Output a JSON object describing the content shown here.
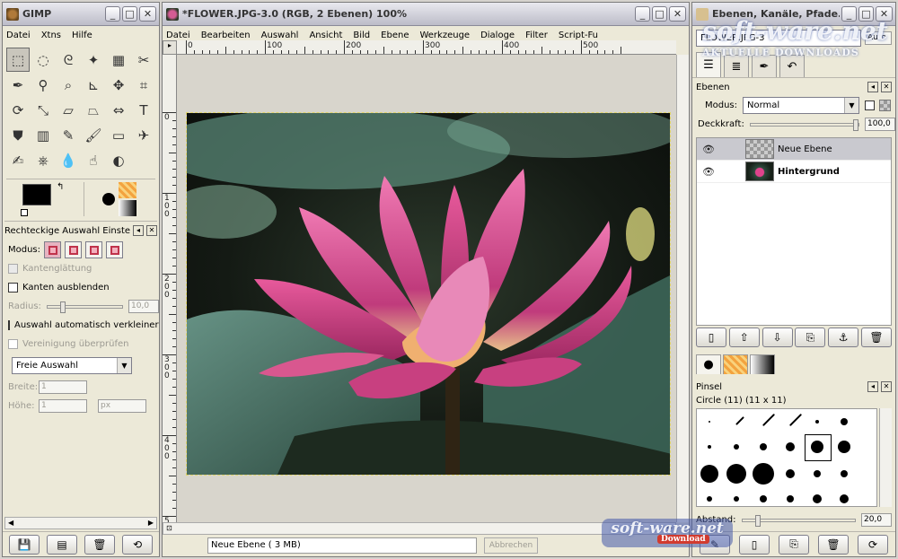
{
  "toolbox": {
    "title": "GIMP",
    "menu": [
      "Datei",
      "Xtns",
      "Hilfe"
    ],
    "tools": [
      {
        "n": "rect-select-icon",
        "g": "⬚",
        "a": true
      },
      {
        "n": "ellipse-select-icon",
        "g": "◌"
      },
      {
        "n": "lasso-icon",
        "g": "ᘓ"
      },
      {
        "n": "fuzzy-select-icon",
        "g": "✦"
      },
      {
        "n": "color-select-icon",
        "g": "▦"
      },
      {
        "n": "scissors-icon",
        "g": "✂"
      },
      {
        "n": "paths-icon",
        "g": "✒"
      },
      {
        "n": "color-picker-icon",
        "g": "⚲"
      },
      {
        "n": "magnify-icon",
        "g": "⌕"
      },
      {
        "n": "measure-icon",
        "g": "⊾"
      },
      {
        "n": "move-icon",
        "g": "✥"
      },
      {
        "n": "crop-icon",
        "g": "⌗"
      },
      {
        "n": "rotate-icon",
        "g": "⟳"
      },
      {
        "n": "scale-icon",
        "g": "⤡"
      },
      {
        "n": "shear-icon",
        "g": "▱"
      },
      {
        "n": "perspective-icon",
        "g": "⏢"
      },
      {
        "n": "flip-icon",
        "g": "⇔"
      },
      {
        "n": "text-icon",
        "g": "T"
      },
      {
        "n": "bucket-fill-icon",
        "g": "⛊"
      },
      {
        "n": "blend-icon",
        "g": "▥"
      },
      {
        "n": "pencil-icon",
        "g": "✎"
      },
      {
        "n": "paintbrush-icon",
        "g": "🖌"
      },
      {
        "n": "eraser-icon",
        "g": "▭"
      },
      {
        "n": "airbrush-icon",
        "g": "✈"
      },
      {
        "n": "ink-icon",
        "g": "✍"
      },
      {
        "n": "clone-icon",
        "g": "⎈"
      },
      {
        "n": "blur-icon",
        "g": "💧"
      },
      {
        "n": "smudge-icon",
        "g": "☝"
      },
      {
        "n": "dodge-burn-icon",
        "g": "◐"
      }
    ],
    "options": {
      "title": "Rechteckige Auswahl Einstellu",
      "mode_label": "Modus:",
      "antialias": "Kantenglättung",
      "feather": "Kanten ausblenden",
      "radius_label": "Radius:",
      "radius_value": "10,0",
      "autoshrink": "Auswahl automatisch verkleinern",
      "merged": "Vereinigung überprüfen",
      "selection_mode": "Freie Auswahl",
      "width_label": "Breite:",
      "width_value": "1",
      "height_label": "Höhe:",
      "height_value": "1",
      "unit": "px"
    }
  },
  "image_window": {
    "title": "*FLOWER.JPG-3.0 (RGB, 2 Ebenen) 100%",
    "menu": [
      "Datei",
      "Bearbeiten",
      "Auswahl",
      "Ansicht",
      "Bild",
      "Ebene",
      "Werkzeuge",
      "Dialoge",
      "Filter",
      "Script-Fu"
    ],
    "ruler_h": [
      "0",
      "100",
      "200",
      "300",
      "400",
      "500"
    ],
    "ruler_v": [
      "0",
      "100",
      "200",
      "300",
      "400",
      "5"
    ],
    "status": "Neue Ebene ( 3 MB)",
    "cancel": "Abbrechen"
  },
  "dock": {
    "title": "Ebenen, Kanäle, Pfade...",
    "image_select": "FLOWER.JPG-3",
    "auto_label": "Auto",
    "layers_title": "Ebenen",
    "mode_label": "Modus:",
    "mode_value": "Normal",
    "opacity_label": "Deckkraft:",
    "opacity_value": "100,0",
    "layers": [
      {
        "name": "Neue Ebene",
        "thumb": "check",
        "sel": true
      },
      {
        "name": "Hintergrund",
        "thumb": "flower",
        "sel": false
      }
    ],
    "brushes_title": "Pinsel",
    "brush_name": "Circle (11) (11 x 11)",
    "spacing_label": "Abstand:",
    "spacing_value": "20,0"
  },
  "watermarks": {
    "top_main": "soft-ware.net",
    "top_sub": "AKTUELLE DOWNLOADS",
    "bottom_main": "soft-ware.net",
    "bottom_sub": "Download"
  }
}
